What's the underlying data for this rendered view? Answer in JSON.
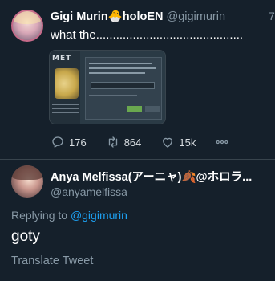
{
  "tweet": {
    "author_name": "Gigi Murin🐣holoEN",
    "author_handle": "@gigimurin",
    "time_partial": "7",
    "text": "what the............................................",
    "actions": {
      "replies": "176",
      "retweets": "864",
      "likes": "15k"
    }
  },
  "reply": {
    "author_name": "Anya Melfissa(アーニャ)🍂@ホロラ...",
    "author_handle": "@anyamelfissa",
    "replying_prefix": "Replying to",
    "replying_to": "@gigimurin",
    "text": "goty",
    "translate_label": "Translate Tweet"
  },
  "media": {
    "left_text": "MET"
  },
  "colors": {
    "background": "#15202b",
    "muted": "#8899a6",
    "link": "#1da1f2",
    "divider": "#38444d"
  }
}
